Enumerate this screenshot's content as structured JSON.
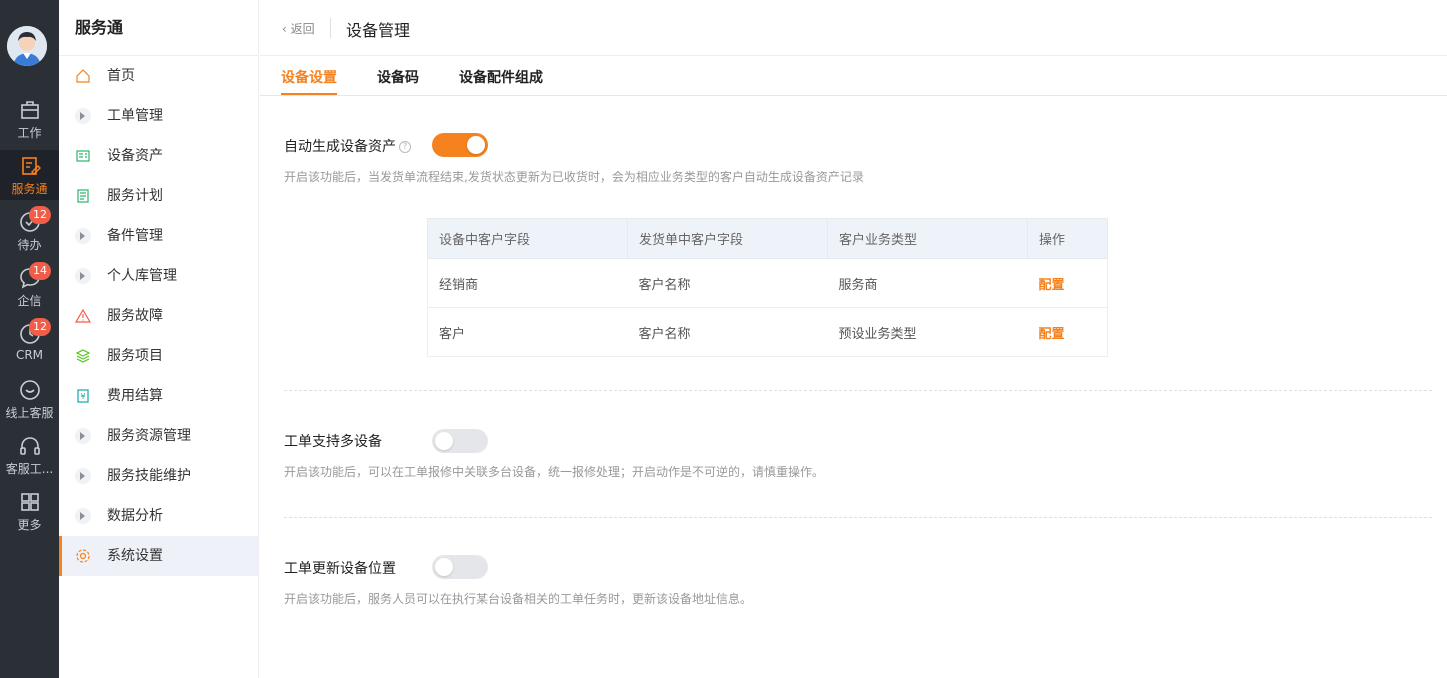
{
  "rail": {
    "items": [
      {
        "label": "工作",
        "icon": "briefcase-icon"
      },
      {
        "label": "服务通",
        "icon": "service-icon",
        "active": true
      },
      {
        "label": "待办",
        "icon": "check-circle-icon",
        "badge": "12"
      },
      {
        "label": "企信",
        "icon": "chat-icon",
        "badge": "14"
      },
      {
        "label": "CRM",
        "icon": "clock-icon",
        "badge": "12"
      },
      {
        "label": "线上客服",
        "icon": "online-service-icon"
      },
      {
        "label": "客服工...",
        "icon": "headset-icon"
      },
      {
        "label": "更多",
        "icon": "grid-icon"
      }
    ]
  },
  "menu": {
    "title": "服务通",
    "items": [
      {
        "label": "首页",
        "icon": "home-icon"
      },
      {
        "label": "工单管理",
        "icon": "expand-icon"
      },
      {
        "label": "设备资产",
        "icon": "device-asset-icon"
      },
      {
        "label": "服务计划",
        "icon": "plan-icon"
      },
      {
        "label": "备件管理",
        "icon": "expand-icon"
      },
      {
        "label": "个人库管理",
        "icon": "expand-icon"
      },
      {
        "label": "服务故障",
        "icon": "warning-icon"
      },
      {
        "label": "服务项目",
        "icon": "layers-icon"
      },
      {
        "label": "费用结算",
        "icon": "yen-icon"
      },
      {
        "label": "服务资源管理",
        "icon": "expand-icon"
      },
      {
        "label": "服务技能维护",
        "icon": "expand-icon"
      },
      {
        "label": "数据分析",
        "icon": "expand-icon"
      },
      {
        "label": "系统设置",
        "icon": "gear-icon",
        "active": true
      }
    ]
  },
  "header": {
    "back": "返回",
    "title": "设备管理"
  },
  "tabs": [
    "设备设置",
    "设备码",
    "设备配件组成"
  ],
  "settings": {
    "auto_asset": {
      "label": "自动生成设备资产",
      "enabled": true,
      "desc": "开启该功能后，当发货单流程结束,发货状态更新为已收货时，会为相应业务类型的客户自动生成设备资产记录"
    },
    "multi_device": {
      "label": "工单支持多设备",
      "enabled": false,
      "desc": "开启该功能后，可以在工单报修中关联多台设备，统一报修处理；开启动作是不可逆的，请慎重操作。"
    },
    "update_location": {
      "label": "工单更新设备位置",
      "enabled": false,
      "desc": "开启该功能后，服务人员可以在执行某台设备相关的工单任务时，更新该设备地址信息。"
    }
  },
  "table": {
    "headers": [
      "设备中客户字段",
      "发货单中客户字段",
      "客户业务类型",
      "操作"
    ],
    "rows": [
      [
        "经销商",
        "客户名称",
        "服务商",
        "配置"
      ],
      [
        "客户",
        "客户名称",
        "预设业务类型",
        "配置"
      ]
    ]
  },
  "colors": {
    "accent": "#f5821f",
    "rail_bg": "#2b2f36",
    "badge": "#f25d4a"
  }
}
